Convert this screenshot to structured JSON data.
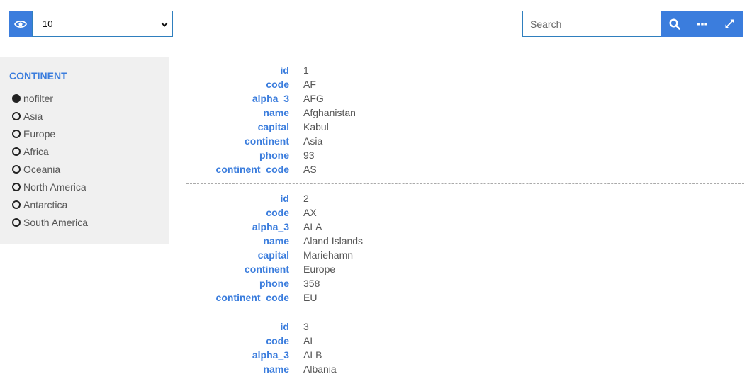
{
  "toolbar": {
    "page_size": "10",
    "search_placeholder": "Search"
  },
  "colors": {
    "accent": "#3b7ddd",
    "sidebar_bg": "#f0f0f0"
  },
  "sidebar": {
    "title": "CONTINENT",
    "filters": [
      {
        "label": "nofilter",
        "checked": true
      },
      {
        "label": "Asia",
        "checked": false
      },
      {
        "label": "Europe",
        "checked": false
      },
      {
        "label": "Africa",
        "checked": false
      },
      {
        "label": "Oceania",
        "checked": false
      },
      {
        "label": "North America",
        "checked": false
      },
      {
        "label": "Antarctica",
        "checked": false
      },
      {
        "label": "South America",
        "checked": false
      }
    ]
  },
  "records": [
    [
      {
        "key": "id",
        "value": "1"
      },
      {
        "key": "code",
        "value": "AF"
      },
      {
        "key": "alpha_3",
        "value": "AFG"
      },
      {
        "key": "name",
        "value": "Afghanistan"
      },
      {
        "key": "capital",
        "value": "Kabul"
      },
      {
        "key": "continent",
        "value": "Asia"
      },
      {
        "key": "phone",
        "value": "93"
      },
      {
        "key": "continent_code",
        "value": "AS"
      }
    ],
    [
      {
        "key": "id",
        "value": "2"
      },
      {
        "key": "code",
        "value": "AX"
      },
      {
        "key": "alpha_3",
        "value": "ALA"
      },
      {
        "key": "name",
        "value": "Aland Islands"
      },
      {
        "key": "capital",
        "value": "Mariehamn"
      },
      {
        "key": "continent",
        "value": "Europe"
      },
      {
        "key": "phone",
        "value": "358"
      },
      {
        "key": "continent_code",
        "value": "EU"
      }
    ],
    [
      {
        "key": "id",
        "value": "3"
      },
      {
        "key": "code",
        "value": "AL"
      },
      {
        "key": "alpha_3",
        "value": "ALB"
      },
      {
        "key": "name",
        "value": "Albania"
      }
    ]
  ]
}
